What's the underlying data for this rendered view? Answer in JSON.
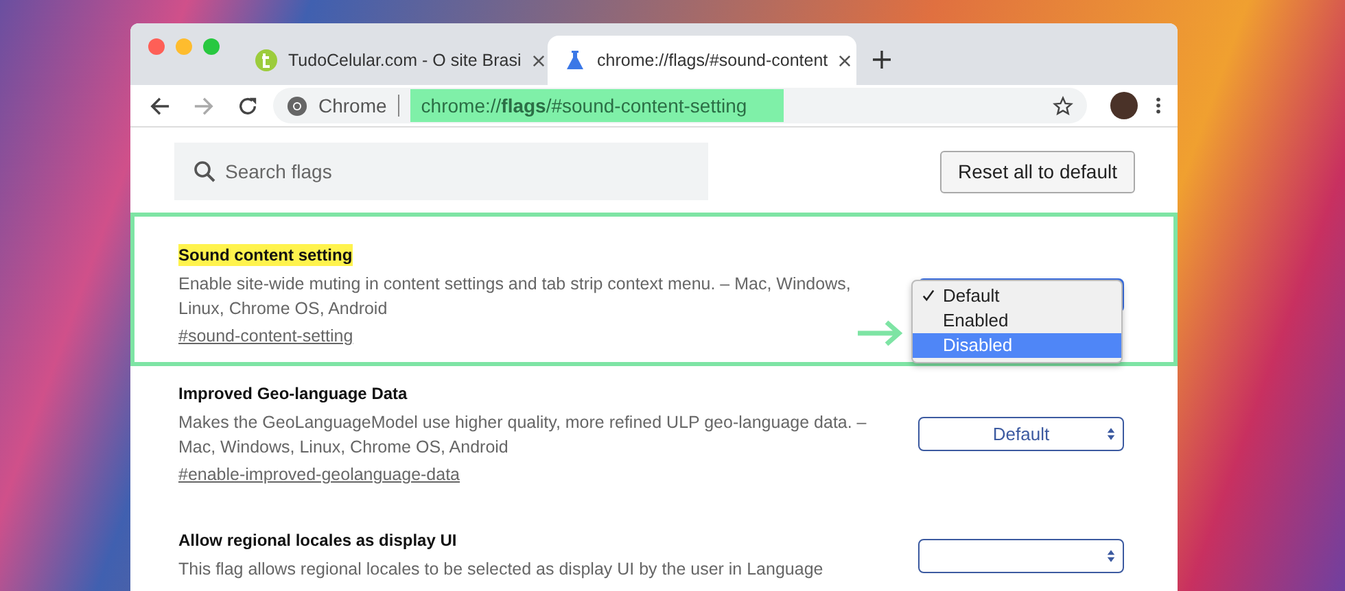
{
  "tabs": [
    {
      "title": "TudoCelular.com - O site Brasi",
      "selected": false
    },
    {
      "title": "chrome://flags/#sound-content",
      "selected": true
    }
  ],
  "toolbar": {
    "chip": "Chrome",
    "url": "chrome://**flags**/#sound-content-setting",
    "url_highlighted": true
  },
  "search": {
    "placeholder": "Search flags"
  },
  "reset_button": "Reset all to default",
  "flags": [
    {
      "title": "Sound content setting",
      "highlighted": true,
      "description": "Enable site-wide muting in content settings and tab strip context menu. – Mac, Windows, Linux, Chrome OS, Android",
      "link": "#sound-content-setting",
      "pointer_arrow": true,
      "select": {
        "open": true,
        "options": [
          {
            "label": "Default",
            "checked": true,
            "selected": false
          },
          {
            "label": "Enabled",
            "checked": false,
            "selected": false
          },
          {
            "label": "Disabled",
            "checked": false,
            "selected": true
          }
        ]
      }
    },
    {
      "title": "Improved Geo-language Data",
      "highlighted": false,
      "description": "Makes the GeoLanguageModel use higher quality, more refined ULP geo-language data. – Mac, Windows, Linux, Chrome OS, Android",
      "link": "#enable-improved-geolanguage-data",
      "pointer_arrow": false,
      "select": {
        "open": false,
        "value": "Default"
      }
    },
    {
      "title": "Allow regional locales as display UI",
      "highlighted": false,
      "description": "This flag allows regional locales to be selected as display UI by the user in Language",
      "pointer_arrow": false,
      "select": {
        "open": false
      }
    }
  ]
}
